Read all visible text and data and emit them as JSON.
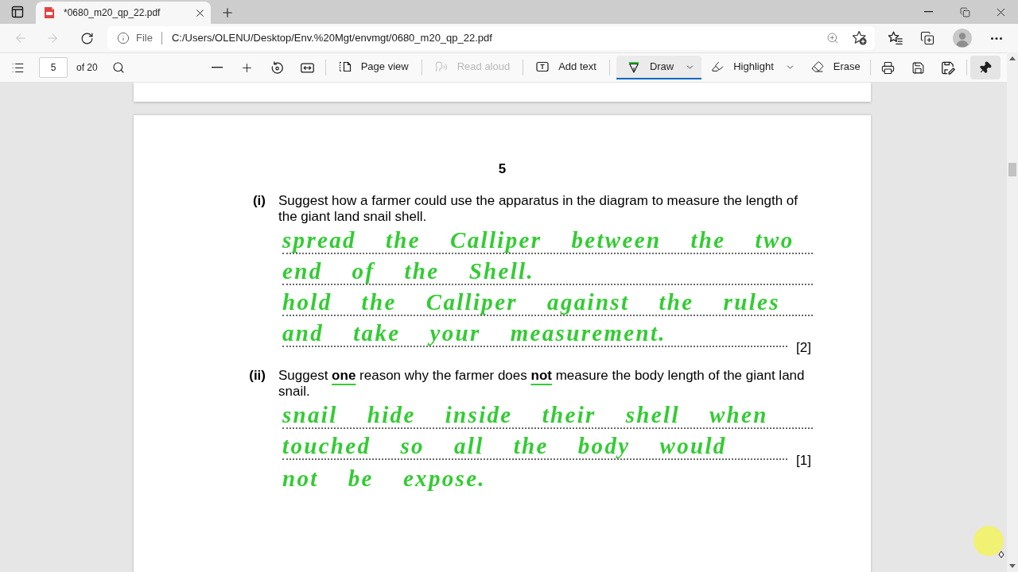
{
  "browser": {
    "tabs": [
      {
        "title": "*0680_m20_qp_22.pdf",
        "selected": true
      }
    ],
    "address_bar": {
      "scheme": "File",
      "url": "C:/Users/OLENU/Desktop/Env.%20Mgt/envmgt/0680_m20_qp_22.pdf",
      "back_disabled": true,
      "forward_disabled": true
    }
  },
  "pdf_toolbar": {
    "page_field": "5",
    "page_count": "of 20",
    "pinned": true,
    "tool_groups": [
      [
        {
          "kind": "view",
          "label": "Page view",
          "selected": false,
          "disabled": false,
          "has_menu": false
        }
      ],
      [
        {
          "kind": "read",
          "label": "Read aloud",
          "selected": false,
          "disabled": true,
          "has_menu": false
        }
      ],
      [
        {
          "kind": "text",
          "label": "Add text",
          "selected": false,
          "disabled": false,
          "has_menu": false
        }
      ],
      [
        {
          "kind": "draw",
          "label": "Draw",
          "selected": true,
          "disabled": false,
          "has_menu": true
        },
        {
          "kind": "highlight",
          "label": "Highlight",
          "selected": false,
          "disabled": false,
          "has_menu": true
        },
        {
          "kind": "erase",
          "label": "Erase",
          "selected": false,
          "disabled": false,
          "has_menu": false
        }
      ]
    ]
  },
  "document": {
    "page_number": "5",
    "questions": [
      {
        "label": "(i)",
        "text": "Suggest how a farmer could use the apparatus in the diagram to measure the length of the giant land snail shell.",
        "answer_lines": [
          {
            "kind": "ruled",
            "handwriting": "spread the Calliper between the two"
          },
          {
            "kind": "ruled",
            "handwriting": "end of the Shell."
          },
          {
            "kind": "ruled",
            "handwriting": "hold the Calliper against the rules"
          },
          {
            "kind": "ruled",
            "handwriting": "and take your measurement.",
            "mark": "[2]"
          }
        ]
      },
      {
        "label": "(ii)",
        "text": "Suggest **one** reason why the farmer does **not** measure the body length of the giant land snail.",
        "ink_underline": true,
        "answer_lines": [
          {
            "kind": "ruled",
            "handwriting": "snail hide inside their shell when"
          },
          {
            "kind": "ruled",
            "handwriting": "touched so all the body would",
            "mark": "[1]"
          },
          {
            "kind": "loose",
            "handwriting": "not be expose."
          }
        ]
      }
    ]
  }
}
